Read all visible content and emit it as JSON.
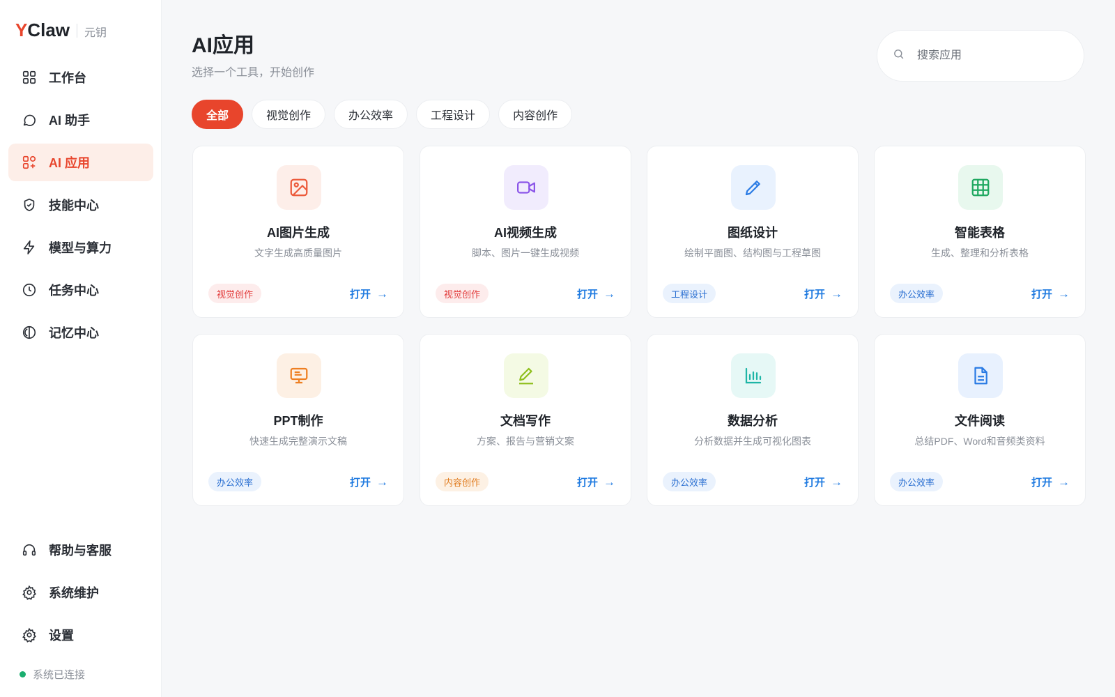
{
  "brand": {
    "logo_first": "Y",
    "logo_rest": "Claw",
    "subtitle": "元钥"
  },
  "sidebar": {
    "items": [
      {
        "label": "工作台",
        "icon": "grid-icon",
        "active": false
      },
      {
        "label": "AI 助手",
        "icon": "chat-bubble-icon",
        "active": false
      },
      {
        "label": "AI 应用",
        "icon": "apps-add-icon",
        "active": true
      },
      {
        "label": "技能中心",
        "icon": "shield-check-icon",
        "active": false
      },
      {
        "label": "模型与算力",
        "icon": "lightning-icon",
        "active": false
      },
      {
        "label": "任务中心",
        "icon": "clock-icon",
        "active": false
      },
      {
        "label": "记忆中心",
        "icon": "memory-icon",
        "active": false
      }
    ],
    "bottom_items": [
      {
        "label": "帮助与客服",
        "icon": "headphones-icon"
      },
      {
        "label": "系统维护",
        "icon": "gear-icon"
      },
      {
        "label": "设置",
        "icon": "gear-icon"
      }
    ],
    "status": {
      "text": "系统已连接",
      "color": "#1aae6f"
    }
  },
  "header": {
    "title": "AI应用",
    "subtitle": "选择一个工具，开始创作"
  },
  "search": {
    "placeholder": "搜索应用",
    "value": ""
  },
  "tabs": [
    {
      "label": "全部",
      "active": true
    },
    {
      "label": "视觉创作",
      "active": false
    },
    {
      "label": "办公效率",
      "active": false
    },
    {
      "label": "工程设计",
      "active": false
    },
    {
      "label": "内容创作",
      "active": false
    }
  ],
  "apps": [
    {
      "title": "AI图片生成",
      "desc": "文字生成高质量图片",
      "tag": "视觉创作",
      "icon": "image-icon",
      "open": "打开",
      "arrow": "→"
    },
    {
      "title": "AI视频生成",
      "desc": "脚本、图片一键生成视频",
      "tag": "视觉创作",
      "icon": "video-camera-icon",
      "open": "打开",
      "arrow": "→"
    },
    {
      "title": "图纸设计",
      "desc": "绘制平面图、结构图与工程草图",
      "tag": "工程设计",
      "icon": "pencil-icon",
      "open": "打开",
      "arrow": "→"
    },
    {
      "title": "智能表格",
      "desc": "生成、整理和分析表格",
      "tag": "办公效率",
      "icon": "table-icon",
      "open": "打开",
      "arrow": "→"
    },
    {
      "title": "PPT制作",
      "desc": "快速生成完整演示文稿",
      "tag": "办公效率",
      "icon": "presentation-icon",
      "open": "打开",
      "arrow": "→"
    },
    {
      "title": "文档写作",
      "desc": "方案、报告与营销文案",
      "tag": "内容创作",
      "icon": "pen-line-icon",
      "open": "打开",
      "arrow": "→"
    },
    {
      "title": "数据分析",
      "desc": "分析数据并生成可视化图表",
      "tag": "办公效率",
      "icon": "bar-chart-icon",
      "open": "打开",
      "arrow": "→"
    },
    {
      "title": "文件阅读",
      "desc": "总结PDF、Word和音频类资料",
      "tag": "办公效率",
      "icon": "document-icon",
      "open": "打开",
      "arrow": "→"
    }
  ],
  "colors": {
    "accent": "#e8452c",
    "link": "#1f7ae0",
    "status": "#1aae6f"
  }
}
